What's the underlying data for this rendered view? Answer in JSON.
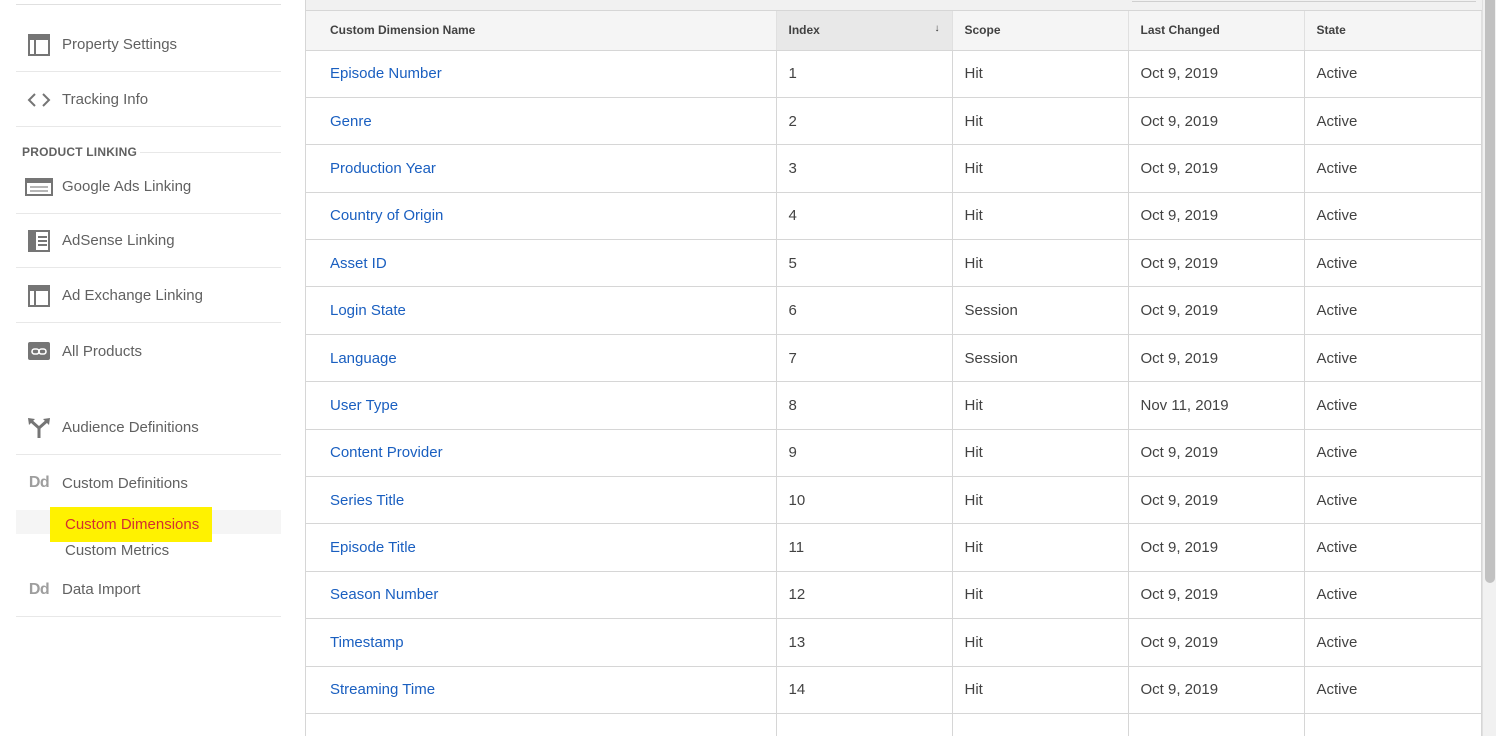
{
  "sidebar": {
    "items": [
      {
        "label": "Property Settings",
        "icon": "window-icon"
      },
      {
        "label": "Tracking Info",
        "icon": "code-icon"
      }
    ],
    "product_linking_header": "PRODUCT LINKING",
    "linking_items": [
      {
        "label": "Google Ads Linking",
        "icon": "ads-icon"
      },
      {
        "label": "AdSense Linking",
        "icon": "adsense-icon"
      },
      {
        "label": "Ad Exchange Linking",
        "icon": "window-icon"
      },
      {
        "label": "All Products",
        "icon": "link-icon"
      }
    ],
    "audience_definitions": {
      "label": "Audience Definitions",
      "icon": "fork-icon"
    },
    "custom_definitions": {
      "label": "Custom Definitions",
      "icon_text": "Dd"
    },
    "custom_dimensions": {
      "label": "Custom Dimensions"
    },
    "custom_metrics": {
      "label": "Custom Metrics"
    },
    "data_import": {
      "label": "Data Import",
      "icon_text": "Dd"
    }
  },
  "table": {
    "columns": [
      "Custom Dimension Name",
      "Index",
      "Scope",
      "Last Changed",
      "State"
    ],
    "sort_indicator": "↓",
    "rows": [
      {
        "name": "Episode Number",
        "index": "1",
        "scope": "Hit",
        "last_changed": "Oct 9, 2019",
        "state": "Active"
      },
      {
        "name": "Genre",
        "index": "2",
        "scope": "Hit",
        "last_changed": "Oct 9, 2019",
        "state": "Active"
      },
      {
        "name": "Production Year",
        "index": "3",
        "scope": "Hit",
        "last_changed": "Oct 9, 2019",
        "state": "Active"
      },
      {
        "name": "Country of Origin",
        "index": "4",
        "scope": "Hit",
        "last_changed": "Oct 9, 2019",
        "state": "Active"
      },
      {
        "name": "Asset ID",
        "index": "5",
        "scope": "Hit",
        "last_changed": "Oct 9, 2019",
        "state": "Active"
      },
      {
        "name": "Login State",
        "index": "6",
        "scope": "Session",
        "last_changed": "Oct 9, 2019",
        "state": "Active"
      },
      {
        "name": "Language",
        "index": "7",
        "scope": "Session",
        "last_changed": "Oct 9, 2019",
        "state": "Active"
      },
      {
        "name": "User Type",
        "index": "8",
        "scope": "Hit",
        "last_changed": "Nov 11, 2019",
        "state": "Active"
      },
      {
        "name": "Content Provider",
        "index": "9",
        "scope": "Hit",
        "last_changed": "Oct 9, 2019",
        "state": "Active"
      },
      {
        "name": "Series Title",
        "index": "10",
        "scope": "Hit",
        "last_changed": "Oct 9, 2019",
        "state": "Active"
      },
      {
        "name": "Episode Title",
        "index": "11",
        "scope": "Hit",
        "last_changed": "Oct 9, 2019",
        "state": "Active"
      },
      {
        "name": "Season Number",
        "index": "12",
        "scope": "Hit",
        "last_changed": "Oct 9, 2019",
        "state": "Active"
      },
      {
        "name": "Timestamp",
        "index": "13",
        "scope": "Hit",
        "last_changed": "Oct 9, 2019",
        "state": "Active"
      },
      {
        "name": "Streaming Time",
        "index": "14",
        "scope": "Hit",
        "last_changed": "Oct 9, 2019",
        "state": "Active"
      }
    ]
  },
  "colors": {
    "link": "#1a5fc0",
    "highlight": "#fff200",
    "active_text": "#d32f2f"
  }
}
